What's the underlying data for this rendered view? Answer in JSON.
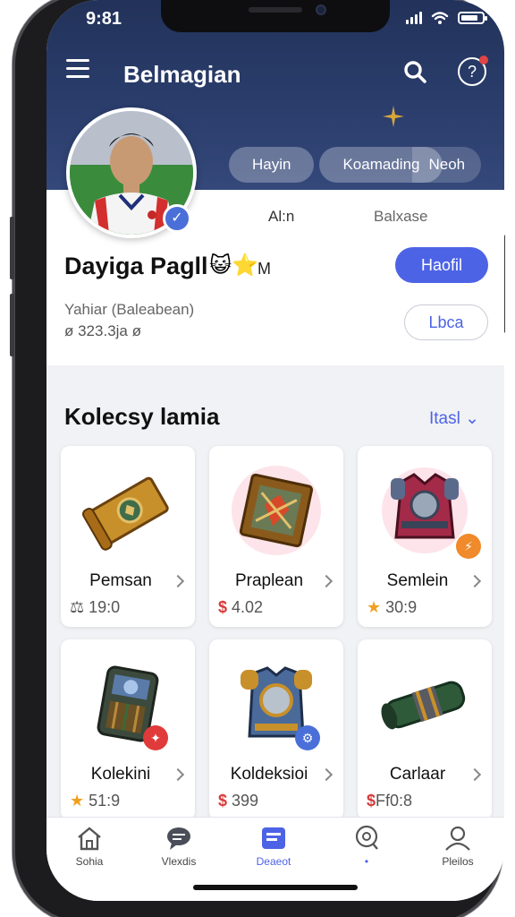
{
  "status_bar": {
    "time": "9:81"
  },
  "header": {
    "title": "Belmagian",
    "tabs": [
      {
        "label": "Hayin"
      },
      {
        "label": "Koamading"
      },
      {
        "label": "Neoh"
      }
    ]
  },
  "profile": {
    "stats": [
      {
        "label": "Al:n"
      },
      {
        "label": "Balxase"
      }
    ],
    "name": "Dayiga Pagll",
    "name_suffix": "M",
    "subtitle": "Yahiar (Baleabean)",
    "meta": "ø 323.3ja ø",
    "follow_label": "Haofil",
    "secondary_label": "Lbca"
  },
  "collection": {
    "title": "Kolecsy lamia",
    "link_label": "Itasl",
    "items": [
      {
        "name": "Pemsan",
        "price": "19:0",
        "currency": "⚖",
        "icon": "scroll-icon"
      },
      {
        "name": "Praplean",
        "price": "4.02",
        "currency": "$",
        "icon": "framed-emblem-icon"
      },
      {
        "name": "Semlein",
        "price": "30:9",
        "currency": "★",
        "icon": "armor-vest-icon"
      },
      {
        "name": "Kolekini",
        "price": "51:9",
        "currency": "★",
        "icon": "backpack-icon"
      },
      {
        "name": "Koldeksioi",
        "price": "399",
        "currency": "$",
        "icon": "chest-armor-icon"
      },
      {
        "name": "Carlaar",
        "price": "Ff0:8",
        "currency": "$",
        "icon": "cannon-icon"
      }
    ]
  },
  "bottom_nav": [
    {
      "label": "Sohia",
      "icon": "home-icon"
    },
    {
      "label": "Vlexdis",
      "icon": "chat-icon"
    },
    {
      "label": "Deaeot",
      "icon": "card-icon"
    },
    {
      "label": "•",
      "icon": "location-icon"
    },
    {
      "label": "Pleilos",
      "icon": "profile-icon"
    }
  ],
  "colors": {
    "accent": "#4d63e6",
    "header": "#2b3e6d",
    "price_red": "#d83a3a",
    "star": "#f0a020"
  }
}
